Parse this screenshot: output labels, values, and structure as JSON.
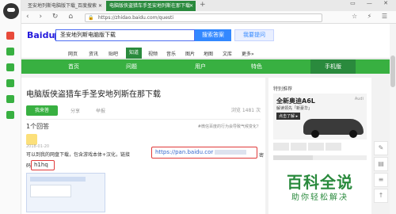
{
  "tabs": [
    {
      "label": "圣安地列斯电脑版下载_百度搜索",
      "close": "✕"
    },
    {
      "label": "电脑版侠盗猎车手圣安地列斯在那下载",
      "close": "✕"
    }
  ],
  "tab_new": "+",
  "window_controls": "▭ — ✕",
  "nav_icons": "‹ › ↻ ⌂",
  "address": {
    "lock": "🔒",
    "url": "https://zhidao.baidu.com/questi"
  },
  "address_right_icons": "☆ ⚡ ☰",
  "logo": {
    "prefix": "Bai",
    "middle": "du",
    "suffix": "知道"
  },
  "search": {
    "query": "圣安地列斯电脑版下载",
    "button": "搜索答案",
    "ask_button": "我要提问"
  },
  "category_nav": [
    "网页",
    "资讯",
    "贴吧",
    "知道",
    "视频",
    "音乐",
    "图片",
    "地图",
    "文库",
    "更多»"
  ],
  "category_active": "知道",
  "green_bar": [
    "首页",
    "问题",
    "用户",
    "特色",
    "手机版"
  ],
  "question": {
    "title": "电脑版侠盗猎车手圣安地列斯在那下载",
    "answer_btn": "我来答",
    "share": "分享",
    "report": "举报",
    "views": "浏览 1481 次"
  },
  "answer": {
    "count": "1个回答",
    "tag": "#微信百度的行为会导致气候变化？",
    "date": "2018-01-20",
    "text": "可以到我的网盘下载，包含游戏本体+汉化，链接",
    "link": "https://pan.baidu.cor",
    "code_label": "码",
    "code": "h1hq",
    "tail_char": "密"
  },
  "sidebar": {
    "title": "特别推荐",
    "ad_title": "全新奥迪A6L",
    "ad_sub": "解读领先「新豪华」",
    "ad_btn": "点击了解 ▸",
    "ad_brand": "Audi",
    "bk_title": "百科全说",
    "bk_sub": "助你轻松解决"
  },
  "float_icons": [
    "✎",
    "▤",
    "≡",
    "↑"
  ]
}
